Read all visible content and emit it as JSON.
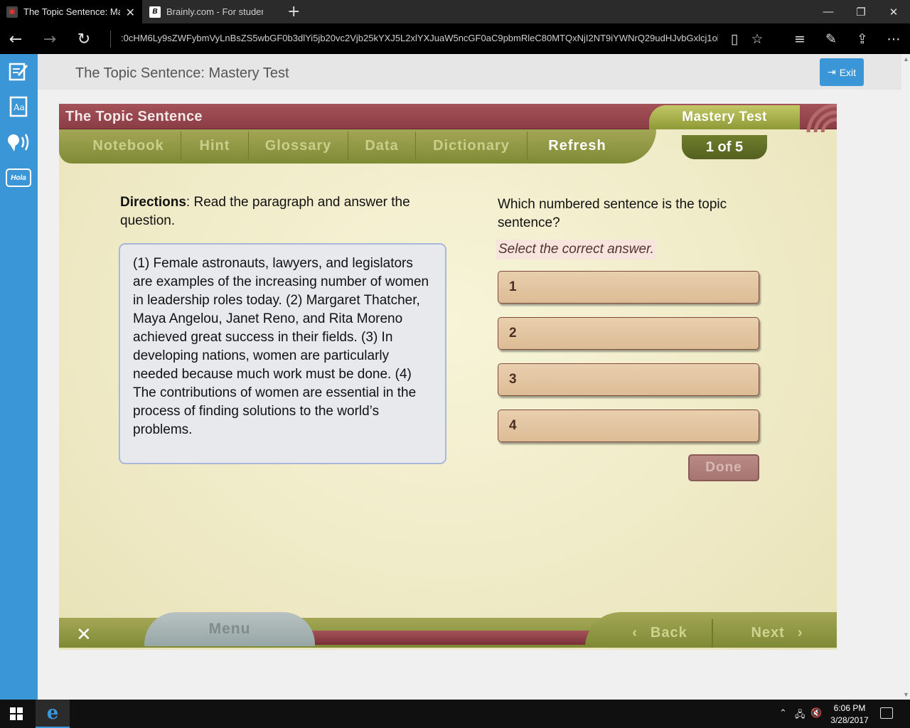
{
  "browser": {
    "tabs": [
      {
        "title": "The Topic Sentence: Ma",
        "active": true
      },
      {
        "title": "Brainly.com - For students. I",
        "active": false
      }
    ],
    "url": ":0cHM6Ly9sZWFybmVyLnBsZS5wbGF0b3dlYi5jb20vc2Vjb25kYXJ5L2xlYXJuaW5ncGF0aC9pbmRleC80MTQxNjI2NT9iYWNrQ29udHJvbGxlcj1ob21l0"
  },
  "page": {
    "title": "The Topic Sentence: Mastery Test",
    "exit_label": "Exit"
  },
  "activity": {
    "title": "The Topic Sentence",
    "badge": "Mastery Test",
    "counter": "1 of 5",
    "toolbar": [
      "Notebook",
      "Hint",
      "Glossary",
      "Data",
      "Dictionary",
      "Refresh"
    ],
    "directions_label": "Directions",
    "directions_text": ": Read the paragraph and answer the question.",
    "passage": "(1) Female astronauts, lawyers, and legislators are examples of the increasing number of women in leadership roles today. (2) Margaret Thatcher, Maya Angelou, Janet Reno, and Rita Moreno achieved great success in their fields. (3) In developing nations, women are particularly needed because much work must be done. (4) The contributions of women are essential in the process of finding solutions to the world’s problems.",
    "question": "Which numbered sentence is the topic sentence?",
    "instruction": "Select the correct answer.",
    "options": [
      "1",
      "2",
      "3",
      "4"
    ],
    "done_label": "Done",
    "bottom": {
      "menu": "Menu",
      "back": "Back",
      "next": "Next"
    }
  },
  "rail": {
    "hola_label": "Hola"
  },
  "taskbar": {
    "time": "6:06 PM",
    "date": "3/28/2017"
  },
  "colors": {
    "accent_blue": "#3a96d6",
    "maroon": "#8a3c44",
    "olive": "#8e9a36"
  }
}
